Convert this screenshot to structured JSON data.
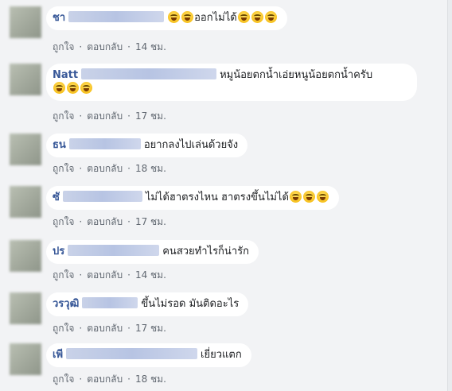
{
  "comments": [
    {
      "name": "ชา",
      "text": "ออกไม่ได้",
      "likes_label": "ถูกใจ",
      "reply_label": "ตอบกลับ",
      "time": "14 ชม."
    },
    {
      "name": "Natt",
      "text": "หมูน้อยตกน้ำเอ่ยหนูน้อยตกน้ำครับ",
      "likes_label": "ถูกใจ",
      "reply_label": "ตอบกลับ",
      "time": "17 ชม."
    },
    {
      "name": "ธน",
      "text": "อยากลงไปเล่นด้วยจัง",
      "likes_label": "ถูกใจ",
      "reply_label": "ตอบกลับ",
      "time": "18 ชม."
    },
    {
      "name": "ซั",
      "text": "ไม่ได้ฮาตรงไหน ฮาตรงขึ้นไม่ได้",
      "likes_label": "ถูกใจ",
      "reply_label": "ตอบกลับ",
      "time": "17 ชม."
    },
    {
      "name": "ปร",
      "text": "คนสวยทำไรก็น่ารัก",
      "likes_label": "ถูกใจ",
      "reply_label": "ตอบกลับ",
      "time": "14 ชม."
    },
    {
      "name": "วรวุฒิ",
      "text": "ขึ้นไม่รอด มันติดอะไร",
      "likes_label": "ถูกใจ",
      "reply_label": "ตอบกลับ",
      "time": "17 ชม."
    },
    {
      "name": "เพี",
      "text": "เยี่ยวแตก",
      "likes_label": "ถูกใจ",
      "reply_label": "ตอบกลับ",
      "time": "18 ชม."
    }
  ],
  "separator": "·",
  "emoji_name": "laughing-emoji",
  "colors": {
    "name": "#385898",
    "bubble": "#ffffff",
    "background": "#f2f3f5",
    "meta": "#606770"
  }
}
